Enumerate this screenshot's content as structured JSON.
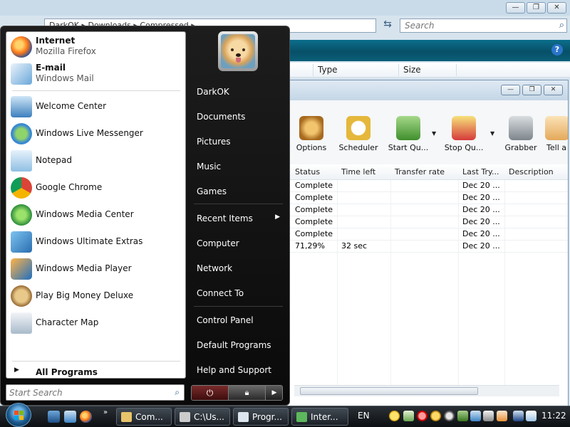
{
  "explorer": {
    "breadcrumb": "DarkOK  ▸  Downloads  ▸  Compressed  ▸",
    "search_placeholder": "Search",
    "columns": [
      "Type",
      "Size"
    ]
  },
  "download_manager": {
    "toolbar": [
      {
        "label": "Options",
        "icon": "gear-icon",
        "color": "#c98a2a"
      },
      {
        "label": "Scheduler",
        "icon": "clock-icon",
        "color": "#e5b73b"
      },
      {
        "label": "Start Qu...",
        "icon": "start-queue-icon",
        "color": "#6aa84f"
      },
      {
        "label": "Stop Qu...",
        "icon": "stop-queue-icon",
        "color": "#e06666"
      },
      {
        "label": "Grabber",
        "icon": "grabber-icon",
        "color": "#9aa0a6"
      },
      {
        "label": "Tell a",
        "icon": "tell-friend-icon",
        "color": "#f1c27d"
      }
    ],
    "columns": [
      "Status",
      "Time left",
      "Transfer rate",
      "Last Try...",
      "Description"
    ],
    "rows": [
      {
        "status": "Complete",
        "time_left": "",
        "rate": "",
        "last_try": "Dec 20 ...",
        "desc": ""
      },
      {
        "status": "Complete",
        "time_left": "",
        "rate": "",
        "last_try": "Dec 20 ...",
        "desc": ""
      },
      {
        "status": "Complete",
        "time_left": "",
        "rate": "",
        "last_try": "Dec 20 ...",
        "desc": ""
      },
      {
        "status": "Complete",
        "time_left": "",
        "rate": "",
        "last_try": "Dec 20 ...",
        "desc": ""
      },
      {
        "status": "Complete",
        "time_left": "",
        "rate": "",
        "last_try": "Dec 20 ...",
        "desc": ""
      },
      {
        "status": "71,29%",
        "time_left": "32 sec",
        "rate": "",
        "last_try": "Dec 20 ...",
        "desc": ""
      }
    ]
  },
  "start_menu": {
    "pinned": [
      {
        "name": "Internet",
        "sub": "Mozilla Firefox"
      },
      {
        "name": "E-mail",
        "sub": "Windows Mail"
      }
    ],
    "recent": [
      "Welcome Center",
      "Windows Live Messenger",
      "Notepad",
      "Google Chrome",
      "Windows Media Center",
      "Windows Ultimate Extras",
      "Windows Media Player",
      "Play Big Money Deluxe",
      "Character Map"
    ],
    "all_programs": "All Programs",
    "search_placeholder": "Start Search",
    "right": {
      "user": "DarkOK",
      "documents": "Documents",
      "pictures": "Pictures",
      "music": "Music",
      "games": "Games",
      "recent_items": "Recent Items",
      "computer": "Computer",
      "network": "Network",
      "connect_to": "Connect To",
      "control_panel": "Control Panel",
      "default_programs": "Default Programs",
      "help_support": "Help and Support"
    }
  },
  "taskbar": {
    "tasks": [
      {
        "label": "Com...",
        "icon": "folder-icon",
        "color": "#e8c46a"
      },
      {
        "label": "C:\\Us...",
        "icon": "archive-icon",
        "color": "#cccccc"
      },
      {
        "label": "Progr...",
        "icon": "window-icon",
        "color": "#dde6ee"
      },
      {
        "label": "Inter...",
        "icon": "download-icon",
        "color": "#5db85d"
      }
    ],
    "language": "EN",
    "clock": "11:22"
  }
}
